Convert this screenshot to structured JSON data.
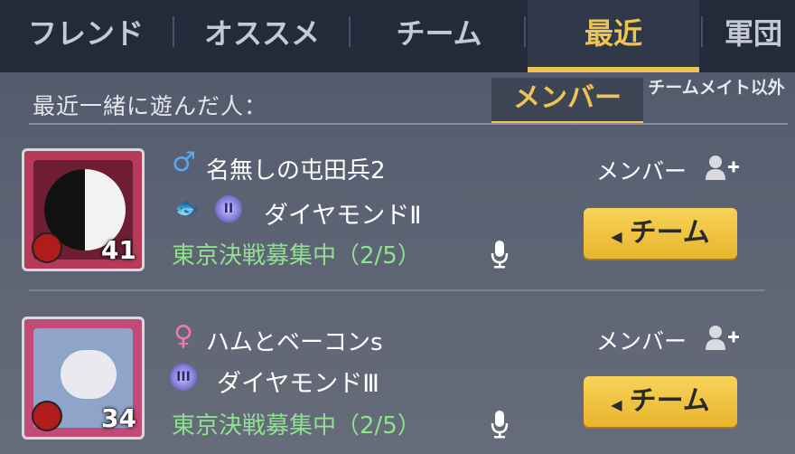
{
  "tabs": [
    {
      "label": "フレンド"
    },
    {
      "label": "オススメ"
    },
    {
      "label": "チーム"
    },
    {
      "label": "最近"
    },
    {
      "label": "軍団"
    }
  ],
  "subheader": {
    "label": "最近一緒に遊んだ人：",
    "members_tab": "メンバー",
    "other_tab": "チームメイト以外"
  },
  "players": [
    {
      "gender_symbol": "♂",
      "name": "名無しの屯田兵2",
      "rank": "ダイヤモンドⅡ",
      "rank_badge": "II",
      "status": "東京決戦募集中（2/5）",
      "level": "41",
      "member_label": "メンバー",
      "team_button": "チーム"
    },
    {
      "gender_symbol": "♀",
      "name": "ハムとベーコンs",
      "rank": "ダイヤモンドⅢ",
      "rank_badge": "III",
      "status": "東京決戦募集中（2/5）",
      "level": "34",
      "member_label": "メンバー",
      "team_button": "チーム"
    }
  ],
  "colors": {
    "accent": "#f0c452",
    "status_green": "#8fe08f",
    "male_blue": "#58a8ee",
    "female_pink": "#ee7aa4"
  }
}
